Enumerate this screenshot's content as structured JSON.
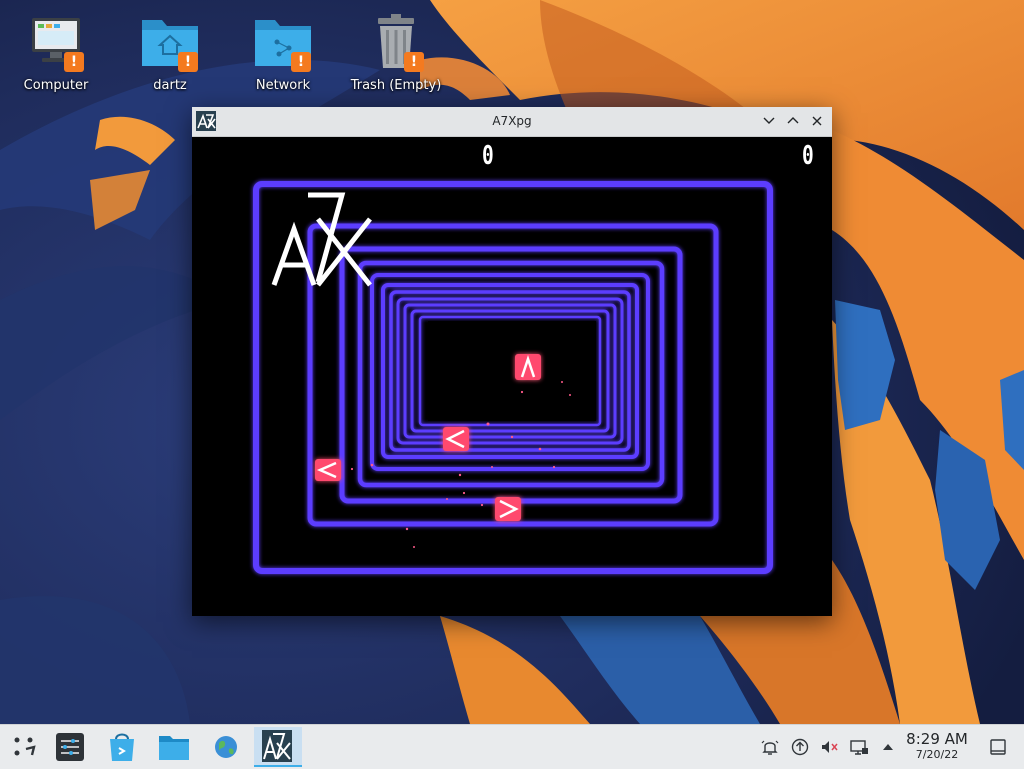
{
  "desktop": {
    "icons": [
      {
        "label": "Computer",
        "icon": "computer-icon"
      },
      {
        "label": "dartz",
        "icon": "home-folder-icon"
      },
      {
        "label": "Network",
        "icon": "network-folder-icon"
      },
      {
        "label": "Trash (Empty)",
        "icon": "trash-icon"
      }
    ],
    "warning_badge": "!"
  },
  "window": {
    "title": "A7Xpg",
    "app_icon": "a7x-app-icon",
    "controls": [
      "minimize-icon",
      "maximize-icon",
      "close-icon"
    ]
  },
  "game": {
    "score_left": "0",
    "score_right": "0",
    "logo_letters": "A7X",
    "colors": {
      "tunnel": "#5b3cff",
      "enemy": "#ff4a6e",
      "background": "#000000"
    }
  },
  "taskbar": {
    "launcher_icon": "application-launcher-icon",
    "tasks": [
      "system-settings-icon",
      "discover-store-icon",
      "file-manager-icon",
      "web-browser-icon",
      "a7xpg-task-icon"
    ],
    "tray": [
      "notifications-icon",
      "updates-icon",
      "volume-muted-icon",
      "network-icon",
      "show-hidden-arrow-icon"
    ],
    "clock": {
      "time": "8:29 AM",
      "date": "7/20/22"
    },
    "show_desktop": "show-desktop-icon"
  },
  "colors": {
    "accent": "#3daee9",
    "warning": "#f47a1f",
    "folder": "#3daee9"
  }
}
